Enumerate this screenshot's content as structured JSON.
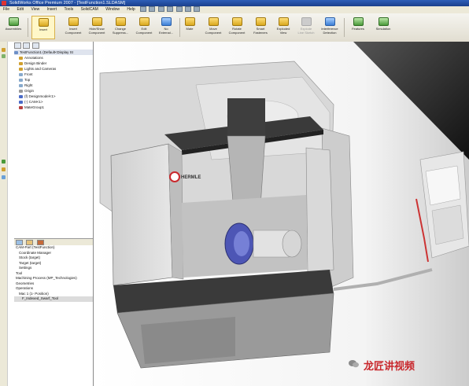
{
  "window": {
    "title": "SolidWorks Office Premium 2007 - [TestFunction1.SLDASM]"
  },
  "menu": {
    "items": [
      "File",
      "Edit",
      "View",
      "Insert",
      "Tools",
      "SolidCAM",
      "Window",
      "Help"
    ]
  },
  "toolbar": {
    "buttons": [
      {
        "label": "Assemblies",
        "label2": ""
      },
      {
        "label": "Insert",
        "label2": ""
      },
      {
        "label": "Insert",
        "label2": "Component"
      },
      {
        "label": "Hide/Show",
        "label2": "Component"
      },
      {
        "label": "Change",
        "label2": "Suppress..."
      },
      {
        "label": "Edit",
        "label2": "Component"
      },
      {
        "label": "No",
        "label2": "External..."
      },
      {
        "label": "Mate",
        "label2": ""
      },
      {
        "label": "Move",
        "label2": "Component"
      },
      {
        "label": "Rotate",
        "label2": "Component"
      },
      {
        "label": "Smart",
        "label2": "Fasteners"
      },
      {
        "label": "Exploded",
        "label2": "View"
      },
      {
        "label": "Explode",
        "label2": "Line Sketch"
      },
      {
        "label": "Interference",
        "label2": "Detection"
      },
      {
        "label": "Features",
        "label2": ""
      },
      {
        "label": "Simulation",
        "label2": ""
      }
    ]
  },
  "tree": {
    "items": [
      {
        "label": "TestFunction1 (Default<Display St",
        "color": "#6d8fc7"
      },
      {
        "label": "Annotations",
        "color": "#d0a030"
      },
      {
        "label": "Design Binder",
        "color": "#d0a030"
      },
      {
        "label": "Lights and Cameras",
        "color": "#d0a030"
      },
      {
        "label": "Front",
        "color": "#88aacc"
      },
      {
        "label": "Top",
        "color": "#88aacc"
      },
      {
        "label": "Right",
        "color": "#88aacc"
      },
      {
        "label": "Origin",
        "color": "#999999"
      },
      {
        "label": "(f) Designmodel<1>",
        "color": "#4a6ac7"
      },
      {
        "label": "(-) CAM<1>",
        "color": "#4a6ac7"
      },
      {
        "label": "MateGroup1",
        "color": "#b84040"
      }
    ]
  },
  "cam_tree": {
    "items": [
      "CAM-Part (TestFunction)",
      "Coordinate Manager",
      "Stock (target)",
      "Target (target)",
      "Settings",
      "Tool",
      "Machining Process (MP_Technologies)",
      "Geometries",
      "Operations",
      "Mac 1 (1- Position)",
      "F_Indexed_Swarf_Tool"
    ]
  },
  "viewport": {
    "machine_logo": "HERMLE",
    "background_color": "#ffffff",
    "corner_color": "#1a1a1a"
  },
  "watermark": {
    "text": "龙匠讲视频"
  },
  "colors": {
    "accent": "#1a3f8c",
    "title_red": "#c9282d"
  }
}
